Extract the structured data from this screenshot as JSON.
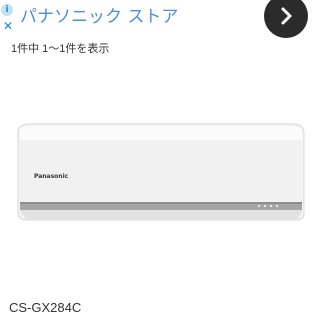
{
  "ad": {
    "info_glyph": "i",
    "close_glyph": "✕",
    "title": "パナソニック ストア",
    "go_icon": "chevron-right-icon"
  },
  "results": {
    "count_text": "1件中 1〜1件を表示"
  },
  "product": {
    "brand_mark": "Panasonic",
    "name": "CS-GX284C"
  }
}
